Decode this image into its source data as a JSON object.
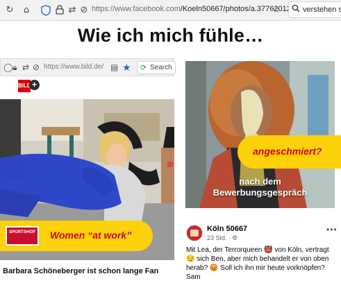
{
  "browser": {
    "url_prefix": "https://www.facebook.com",
    "url_path": "/Koeln50667/photos/a.37762012",
    "search_text": "verstehen sie"
  },
  "headline": "Wie ich mich fühle…",
  "left_card": {
    "url": "https://www.bild.de/",
    "search_label": "Search",
    "logo_text": "BILD",
    "ad_label": "SPORTSHOP",
    "banner_text": "Women “at work”",
    "caption": "Barbara Schöneberger ist schon lange Fan"
  },
  "right_card": {
    "banner_text": "angeschmiert?",
    "overlay_line1": "nach dem",
    "overlay_line2": "Bewerbungsgespräch"
  },
  "post": {
    "page_name": "Köln 50667",
    "time": "23 Std. · ",
    "text": "Mit Lea, der Terrorqueen 👹 von Köln, vertragt 😏 sich Ben, aber mich behandelt er von oben herab? 😡 Soll ich ihn mir heute vorknöpfen? Sam"
  },
  "colors": {
    "banner_yellow": "#fdd20b",
    "banner_red": "#d2001b",
    "bild_red": "#dd0000"
  }
}
